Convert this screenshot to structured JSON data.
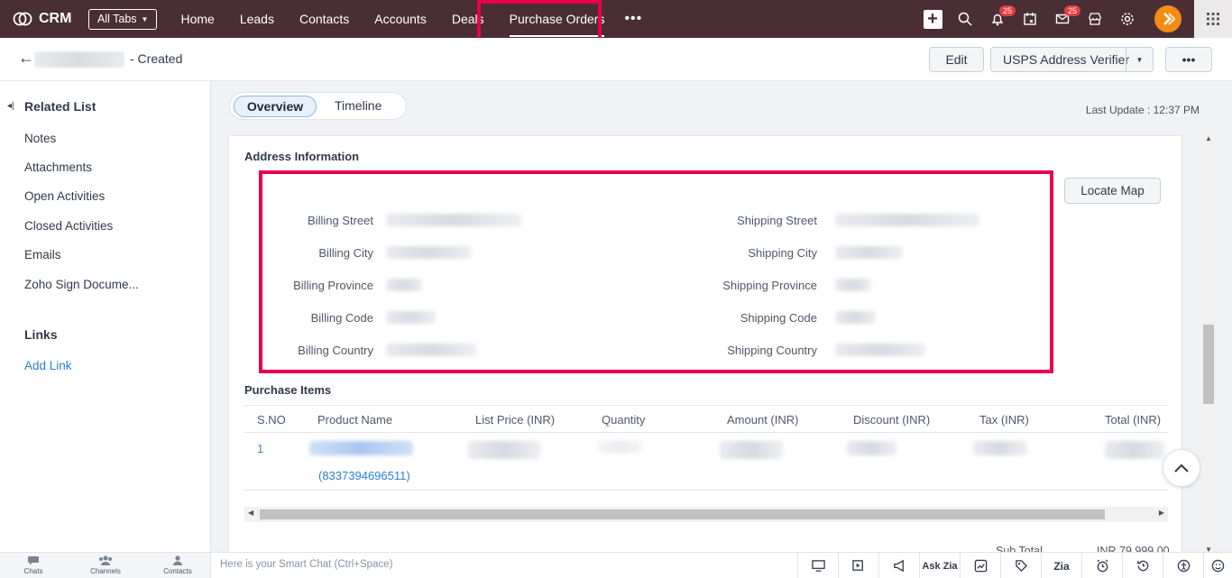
{
  "topnav": {
    "brand": "CRM",
    "all_tabs": "All Tabs",
    "tabs": [
      "Home",
      "Leads",
      "Contacts",
      "Accounts",
      "Deals",
      "Purchase Orders"
    ],
    "active_tab": "Purchase Orders",
    "more": "•••",
    "notifications_badge": "25",
    "mail_badge": "25"
  },
  "record": {
    "status": "- Created",
    "buttons": {
      "edit": "Edit",
      "usps": "USPS Address Verifier",
      "more": "•••"
    }
  },
  "sidebar": {
    "related_title": "Related List",
    "items": [
      "Notes",
      "Attachments",
      "Open Activities",
      "Closed Activities",
      "Emails",
      "Zoho Sign Docume..."
    ],
    "links_title": "Links",
    "add_link": "Add Link"
  },
  "main": {
    "tabs": {
      "overview": "Overview",
      "timeline": "Timeline"
    },
    "last_update": "Last Update : 12:37 PM",
    "address_title": "Address Information",
    "locate_map": "Locate Map",
    "billing_labels": [
      "Billing Street",
      "Billing City",
      "Billing Province",
      "Billing Code",
      "Billing Country"
    ],
    "shipping_labels": [
      "Shipping Street",
      "Shipping City",
      "Shipping Province",
      "Shipping Code",
      "Shipping Country"
    ],
    "items_title": "Purchase Items",
    "columns": [
      "S.NO",
      "Product Name",
      "List Price (INR)",
      "Quantity",
      "Amount (INR)",
      "Discount (INR)",
      "Tax (INR)",
      "Total (INR)"
    ],
    "row1": {
      "sno": "1",
      "product_code": "(8337394696511)"
    },
    "subtotal_label": "Sub Total",
    "subtotal_value": "INR 79,999.00"
  },
  "bottombar": {
    "left": [
      "Chats",
      "Channels",
      "Contacts"
    ],
    "chat_placeholder": "Here is your Smart Chat (Ctrl+Space)",
    "ask_zia": "Ask Zia"
  }
}
